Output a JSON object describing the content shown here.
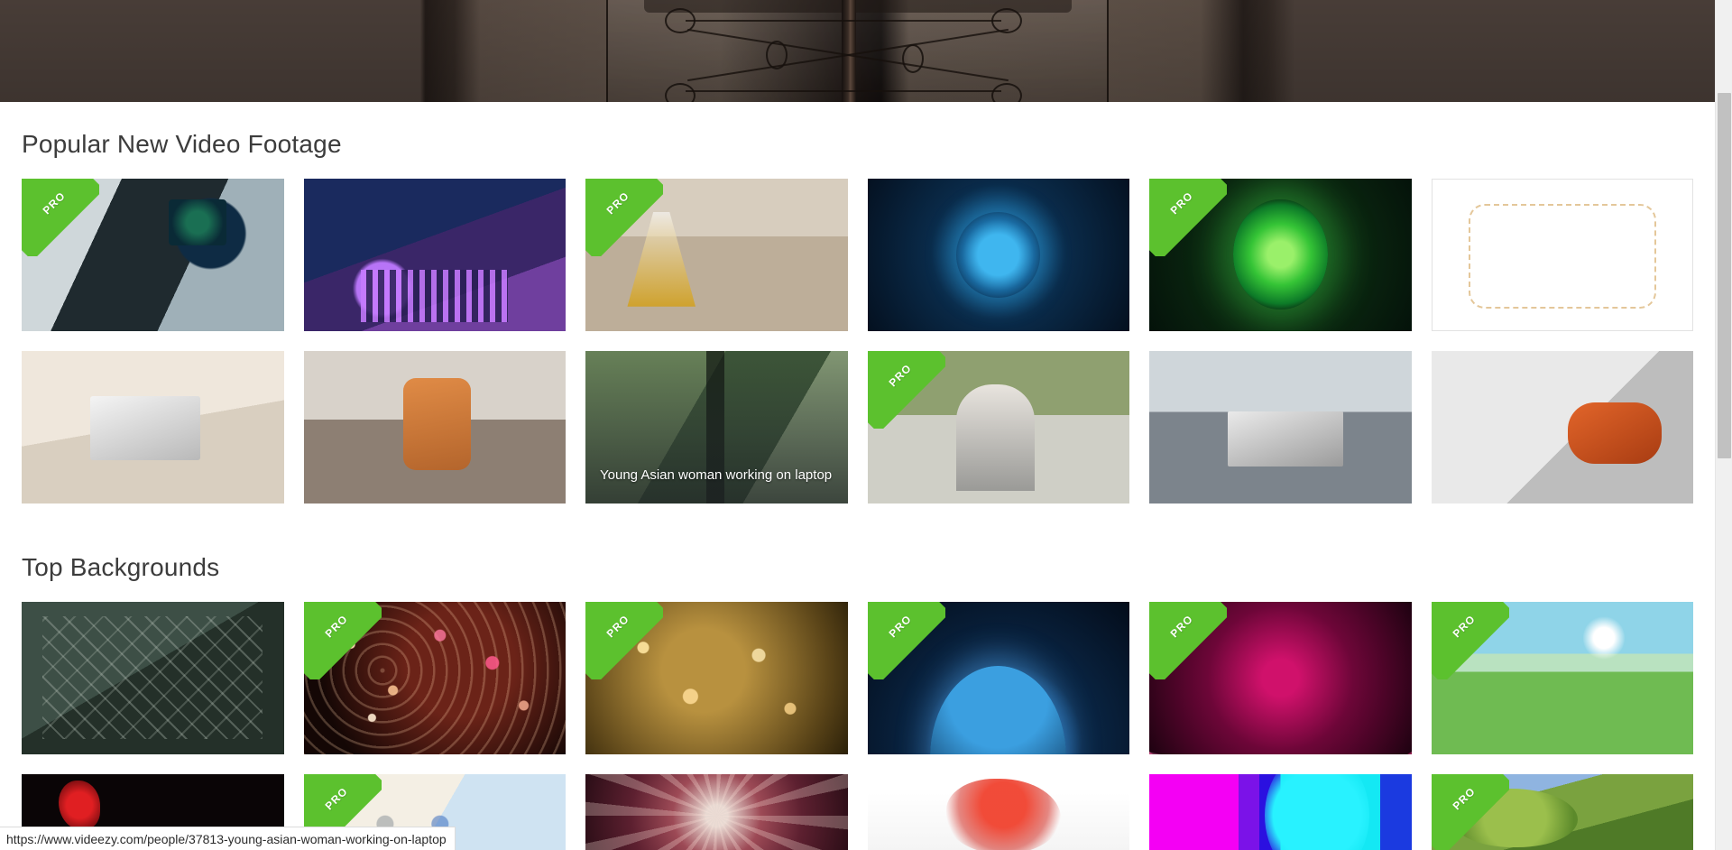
{
  "browser": {
    "status_url": "https://www.videezy.com/people/37813-young-asian-woman-working-on-laptop"
  },
  "banner": {
    "name": "hero-banner-image"
  },
  "badges": {
    "pro_label": "PRO"
  },
  "colors": {
    "pro_green": "#5cc12e",
    "heading_gray": "#3c3c3c",
    "page_background": "#ffffff",
    "scrollbar_track": "#f0f0f0",
    "scrollbar_thumb": "#c1c1c1",
    "banner_brown": "#534640"
  },
  "sections": [
    {
      "title": "Popular New Video Footage",
      "rows": [
        {
          "cards": [
            {
              "art": "t-microscope",
              "pro": true,
              "caption": null,
              "framed": false
            },
            {
              "art": "t-pipette",
              "pro": false,
              "caption": null,
              "framed": false
            },
            {
              "art": "t-lab",
              "pro": true,
              "caption": null,
              "framed": false
            },
            {
              "art": "t-virus",
              "pro": false,
              "caption": null,
              "framed": false
            },
            {
              "art": "t-cell",
              "pro": true,
              "caption": null,
              "framed": false
            },
            {
              "art": "t-illus",
              "pro": false,
              "caption": null,
              "framed": true
            }
          ]
        },
        {
          "cards": [
            {
              "art": "t-laptopdesk",
              "pro": false,
              "caption": null,
              "framed": false
            },
            {
              "art": "t-couple",
              "pro": false,
              "caption": null,
              "framed": false
            },
            {
              "art": "t-window",
              "pro": false,
              "caption": "Young Asian woman working on laptop",
              "framed": false
            },
            {
              "art": "t-mask",
              "pro": true,
              "caption": null,
              "framed": false
            },
            {
              "art": "t-office",
              "pro": false,
              "caption": null,
              "framed": false
            },
            {
              "art": "t-clean",
              "pro": false,
              "caption": null,
              "framed": false
            }
          ]
        }
      ]
    },
    {
      "title": "Top Backgrounds",
      "rows": [
        {
          "cards": [
            {
              "art": "t-circuit",
              "pro": false,
              "caption": null,
              "framed": false
            },
            {
              "art": "t-bokeh",
              "pro": true,
              "caption": null,
              "framed": false
            },
            {
              "art": "t-gold",
              "pro": true,
              "caption": null,
              "framed": false
            },
            {
              "art": "t-earth",
              "pro": true,
              "caption": null,
              "framed": false
            },
            {
              "art": "t-magenta",
              "pro": true,
              "caption": null,
              "framed": false
            },
            {
              "art": "t-meadow",
              "pro": true,
              "caption": null,
              "framed": false
            }
          ]
        },
        {
          "cards": [
            {
              "art": "t-dark-red",
              "pro": false,
              "caption": null,
              "framed": false
            },
            {
              "art": "t-map",
              "pro": true,
              "caption": null,
              "framed": false
            },
            {
              "art": "t-kaleido",
              "pro": false,
              "caption": null,
              "framed": false
            },
            {
              "art": "t-ink",
              "pro": false,
              "caption": null,
              "framed": false
            },
            {
              "art": "t-neon",
              "pro": false,
              "caption": null,
              "framed": false
            },
            {
              "art": "t-greenhill",
              "pro": true,
              "caption": null,
              "framed": false
            }
          ]
        }
      ]
    }
  ]
}
